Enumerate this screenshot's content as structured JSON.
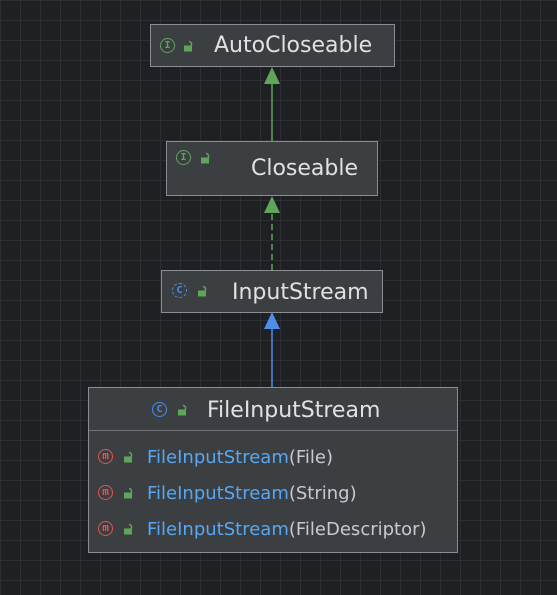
{
  "colors": {
    "background": "#1f2023",
    "grid": "#2c2e32",
    "node_fill": "#3c3f41",
    "node_border": "#8a8d92",
    "interface_icon": "#5fa55a",
    "class_icon": "#4c8ee8",
    "method_icon": "#e05555",
    "method_name": "#56a8f5",
    "extends_edge": "#5fa55a",
    "implements_edge": "#5fa55a",
    "subclass_edge": "#4c8ee8"
  },
  "nodes": {
    "autocloseable": {
      "kind": "interface",
      "kind_icon": "interface-icon",
      "kind_letter": "I",
      "visibility_icon": "public-lock-icon",
      "name": "AutoCloseable"
    },
    "closeable": {
      "kind": "interface",
      "kind_icon": "interface-icon",
      "kind_letter": "I",
      "visibility_icon": "public-lock-icon",
      "name": "Closeable"
    },
    "inputstream": {
      "kind": "abstract-class",
      "kind_icon": "abstract-class-icon",
      "kind_letter": "C",
      "visibility_icon": "public-lock-icon",
      "name": "InputStream"
    },
    "fileinputstream": {
      "kind": "class",
      "kind_icon": "class-icon",
      "kind_letter": "C",
      "visibility_icon": "public-lock-icon",
      "name": "FileInputStream",
      "members": [
        {
          "kind_letter": "m",
          "name": "FileInputStream",
          "params": "(File)"
        },
        {
          "kind_letter": "m",
          "name": "FileInputStream",
          "params": "(String)"
        },
        {
          "kind_letter": "m",
          "name": "FileInputStream",
          "params": "(FileDescriptor)"
        }
      ]
    }
  },
  "edges": [
    {
      "from": "closeable",
      "to": "autocloseable",
      "style": "solid",
      "color": "#5fa55a"
    },
    {
      "from": "inputstream",
      "to": "closeable",
      "style": "dashed",
      "color": "#5fa55a"
    },
    {
      "from": "fileinputstream",
      "to": "inputstream",
      "style": "solid",
      "color": "#4c8ee8"
    }
  ]
}
